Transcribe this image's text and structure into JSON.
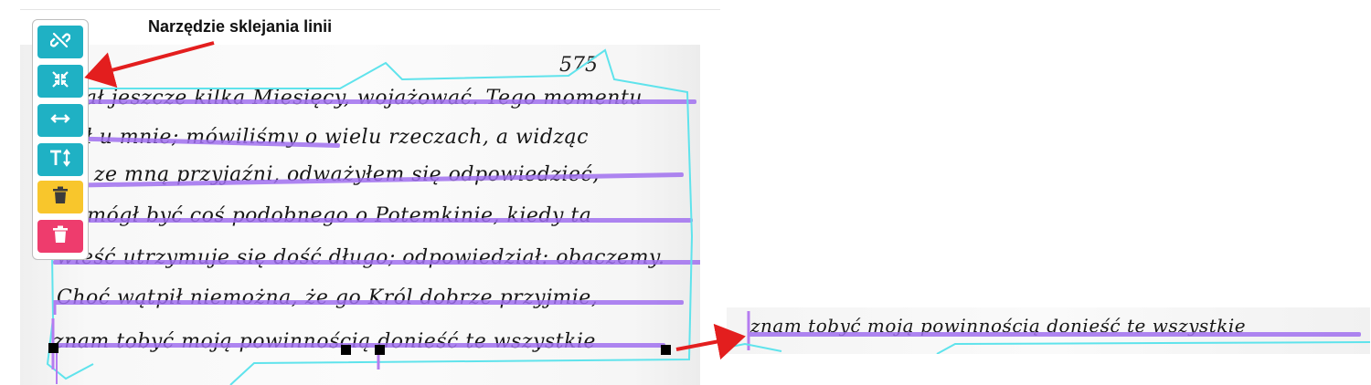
{
  "callout": {
    "label": "Narzędzie sklejania linii"
  },
  "toolbar": {
    "buttons": [
      {
        "icon": "unlink-icon",
        "color": "#1fb1c4"
      },
      {
        "icon": "merge-lines-icon",
        "color": "#1fb1c4"
      },
      {
        "icon": "split-horizontal-icon",
        "color": "#1fb1c4"
      },
      {
        "icon": "text-height-icon",
        "color": "#1fb1c4"
      },
      {
        "icon": "trash-icon",
        "color": "#f8c62c"
      },
      {
        "icon": "trash-icon",
        "color": "#ee3c6d"
      }
    ]
  },
  "manuscript": {
    "page_number": "575",
    "lines": [
      "miał jeszcze kilka Miesięcy, wojażować. Tego momentu",
      "był u mnie; mówiliśmy o wielu rzeczach, a widząc",
      "żeś ze mną przyjaźni, odważyłem się odpowiedzieć,",
      "że mógł być coś podobnego o Potemkinie, kiedy ta",
      "wieść utrzymuje się dość długo; odpowiedział: obaczemy.",
      "Choć wątpił niemożna, że go Król dobrze przyjmie,",
      "znam tobyć moją powinnością donieść te wszystkie"
    ]
  },
  "detail": {
    "line": "znam tobyć moją powinnością donieść te wszystkie"
  },
  "colors": {
    "baseline": "#a070ef",
    "region": "#5fe3ec",
    "arrow": "#e31e1e",
    "teal": "#1fb1c4",
    "yellow": "#f8c62c",
    "pink": "#ee3c6d"
  }
}
